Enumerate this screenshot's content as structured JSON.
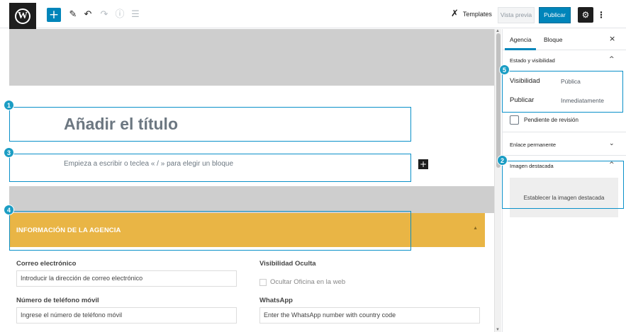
{
  "toolbar": {
    "logo_glyph": "W",
    "add_glyph": "+",
    "edit_glyph": "✎",
    "undo_glyph": "↶",
    "redo_glyph": "↷",
    "info_glyph": "ⓘ",
    "outline_glyph": "☰",
    "templates_glyph": "✗",
    "templates_label": "Templates",
    "preview_label": "Vista previa",
    "publish_label": "Publicar",
    "settings_glyph": "⚙",
    "more_glyph": "⋮"
  },
  "editor": {
    "title_placeholder": "Añadir el título",
    "paragraph_placeholder": "Empieza a escribir o teclea « / » para elegir un bloque",
    "inserter_glyph": "+"
  },
  "metabox": {
    "title": "INFORMACIÓN DE LA AGENCIA",
    "toggle_glyph": "▲",
    "fields": {
      "email_label": "Correo electrónico",
      "email_placeholder": "Introducir la dirección de correo electrónico",
      "hidden_visibility_label": "Visibilidad Oculta",
      "hide_office_label": "Ocultar Oficina en la web",
      "mobile_label": "Número de teléfono móvil",
      "mobile_placeholder": "Ingrese el número de teléfono móvil",
      "whatsapp_label": "WhatsApp",
      "whatsapp_placeholder": "Enter the WhatsApp number with country code"
    }
  },
  "sidebar": {
    "tabs": [
      {
        "label": "Agencia",
        "active": true
      },
      {
        "label": "Bloque",
        "active": false
      }
    ],
    "close_glyph": "×",
    "status_section": {
      "title": "Estado y visibilidad",
      "chevron": "^",
      "visibility_label": "Visibilidad",
      "visibility_value": "Pública",
      "publish_label": "Publicar",
      "publish_value": "Inmediatamente",
      "pending_review_label": "Pendiente de revisión"
    },
    "permalink_section": {
      "title": "Enlace permanente",
      "chevron": "⌄"
    },
    "featured_image_section": {
      "title": "Imagen destacada",
      "chevron": "^",
      "set_label": "Establecer la imagen destacada"
    }
  },
  "callouts": [
    "1",
    "2",
    "3",
    "4",
    "5"
  ],
  "colors": {
    "accent": "#0085ba",
    "metabox_header": "#e9b545",
    "callout": "#1b9dc4",
    "canvas_gray": "#cecece"
  }
}
